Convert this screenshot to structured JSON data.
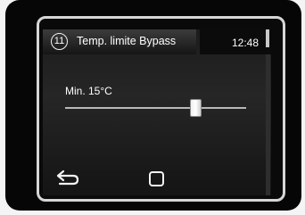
{
  "header": {
    "step_number": "11",
    "title": "Temp. limite Bypass",
    "time": "12:48"
  },
  "setting": {
    "label": "Min. 15°C",
    "slider_level_fraction": 0.72
  },
  "navigation": {
    "back_icon": "back-arrow-icon",
    "home_icon": "square-home-icon"
  }
}
